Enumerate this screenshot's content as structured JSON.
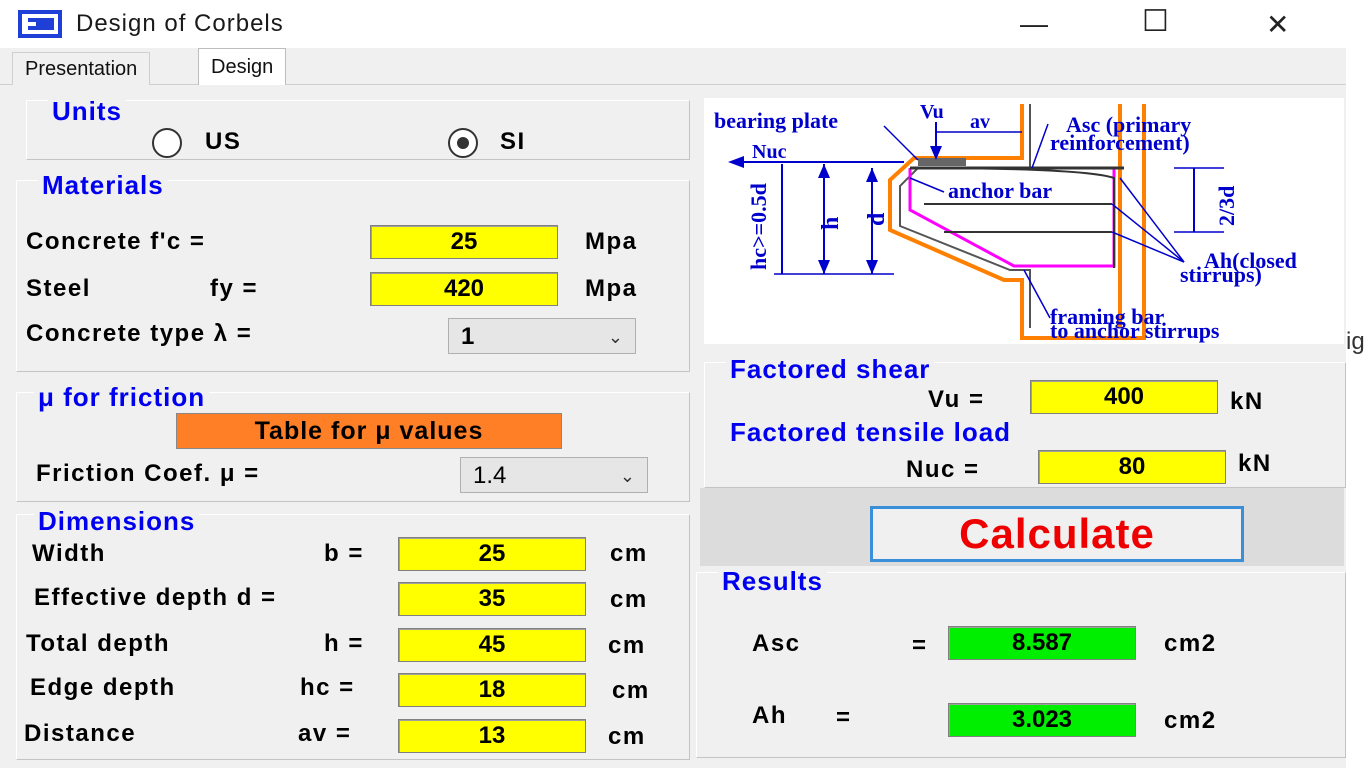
{
  "window": {
    "title": "Design of Corbels",
    "minimize": "—",
    "maximize": "☐",
    "close": "✕"
  },
  "tabs": [
    {
      "label": "Presentation"
    },
    {
      "label": "Design"
    }
  ],
  "units": {
    "title": "Units",
    "us_label": "US",
    "si_label": "SI",
    "selected": "SI"
  },
  "materials": {
    "title": "Materials",
    "concrete_label": "Concrete  f'c =",
    "concrete_value": "25",
    "concrete_unit": "Mpa",
    "steel_label": "Steel",
    "steel_sym": "fy =",
    "steel_value": "420",
    "steel_unit": "Mpa",
    "type_label": "Concrete type  λ =",
    "type_value": "1"
  },
  "friction": {
    "title": "μ for friction",
    "table_button": "Table for μ values",
    "coef_label": "Friction Coef.   μ =",
    "coef_value": "1.4"
  },
  "dimensions": {
    "title": "Dimensions",
    "rows": [
      {
        "label": "Width",
        "sym": "b =",
        "value": "25",
        "unit": "cm"
      },
      {
        "label": "Effective depth d =",
        "sym": "",
        "value": "35",
        "unit": "cm"
      },
      {
        "label": "Total depth",
        "sym": "h =",
        "value": "45",
        "unit": "cm"
      },
      {
        "label": "Edge depth",
        "sym": "hc =",
        "value": "18",
        "unit": "cm"
      },
      {
        "label": "Distance",
        "sym": "av =",
        "value": "13",
        "unit": "cm"
      }
    ]
  },
  "diagram": {
    "bearing_plate": "bearing plate",
    "vu": "Vu",
    "av": "av",
    "asc_line1": "Asc (primary",
    "asc_line2": "reinforcement)",
    "nuc": "Nuc",
    "anchor_bar": "anchor bar",
    "hc_label": "hc>=0.5d",
    "h_label": "h",
    "d_label": "d",
    "two_thirds_d": "2/3d",
    "ah_line1": "Ah(closed",
    "ah_line2": "stirrups)",
    "framing_line1": "framing bar",
    "framing_line2": "to anchor stirrups"
  },
  "shear": {
    "title": "Factored shear",
    "vu_label": "Vu =",
    "vu_value": "400",
    "vu_unit": "kN",
    "tensile_title": "Factored tensile load",
    "nuc_label": "Nuc =",
    "nuc_value": "80",
    "nuc_unit": "kN"
  },
  "calculate_label": "Calculate",
  "results": {
    "title": "Results",
    "asc_label": "Asc",
    "asc_eq": "=",
    "asc_value": "8.587",
    "asc_unit": "cm2",
    "ah_label": "Ah",
    "ah_eq": "=",
    "ah_value": "3.023",
    "ah_unit": "cm2"
  },
  "behind_text": "ig",
  "colors": {
    "yellow_field": "#ffff00",
    "green_field": "#00ee00",
    "group_title": "#0000ee",
    "calc_text": "#ee0000",
    "orange_button": "#ff7f27"
  }
}
